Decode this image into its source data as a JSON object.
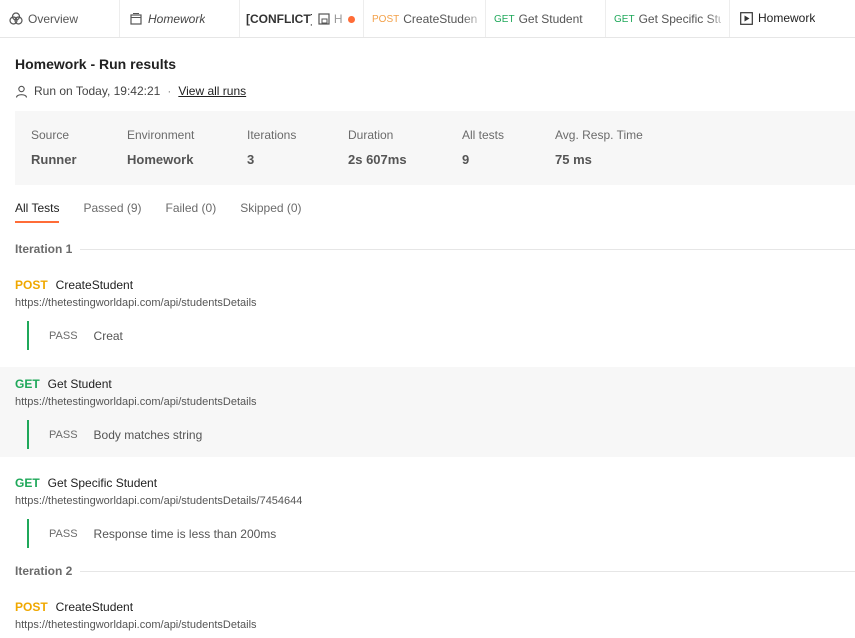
{
  "tabs": [
    {
      "label": "Overview",
      "icon": "overview-icon",
      "style": "normal"
    },
    {
      "label": "Homework",
      "icon": "collection-icon",
      "style": "italic"
    },
    {
      "label": "[CONFLICT]",
      "suffix": "H",
      "icon": "environment-icon",
      "style": "bold",
      "unsaved": true
    },
    {
      "method": "POST",
      "label": "CreateStudent"
    },
    {
      "method": "GET",
      "label": "Get Student"
    },
    {
      "method": "GET",
      "label": "Get Specific Stu"
    },
    {
      "label": "Homework",
      "icon": "runner-play-icon",
      "active": true
    }
  ],
  "header": {
    "title": "Homework - Run results",
    "run_on": "Run on Today, 19:42:21",
    "separator": "·",
    "view_all": "View all runs"
  },
  "summary": [
    {
      "label": "Source",
      "value": "Runner"
    },
    {
      "label": "Environment",
      "value": "Homework"
    },
    {
      "label": "Iterations",
      "value": "3"
    },
    {
      "label": "Duration",
      "value": "2s 607ms"
    },
    {
      "label": "All tests",
      "value": "9"
    },
    {
      "label": "Avg. Resp. Time",
      "value": "75 ms"
    }
  ],
  "filter_tabs": [
    {
      "label": "All Tests",
      "active": true
    },
    {
      "label": "Passed (9)"
    },
    {
      "label": "Failed (0)"
    },
    {
      "label": "Skipped (0)"
    }
  ],
  "iterations": [
    {
      "label": "Iteration 1",
      "requests": [
        {
          "method": "POST",
          "name": "CreateStudent",
          "url": "https://thetestingworldapi.com/api/studentsDetails",
          "status": "PASS",
          "result": "Creat"
        },
        {
          "method": "GET",
          "name": "Get Student",
          "url": "https://thetestingworldapi.com/api/studentsDetails",
          "status": "PASS",
          "result": "Body matches string"
        },
        {
          "method": "GET",
          "name": "Get Specific Student",
          "url": "https://thetestingworldapi.com/api/studentsDetails/7454644",
          "status": "PASS",
          "result": "Response time is less than 200ms"
        }
      ]
    },
    {
      "label": "Iteration 2",
      "requests": [
        {
          "method": "POST",
          "name": "CreateStudent",
          "url": "https://thetestingworldapi.com/api/studentsDetails"
        }
      ]
    }
  ],
  "colors": {
    "accent": "#ff6c37",
    "post": "#f0a800",
    "get": "#1fa85a",
    "pass_bar": "#1fa85a"
  }
}
